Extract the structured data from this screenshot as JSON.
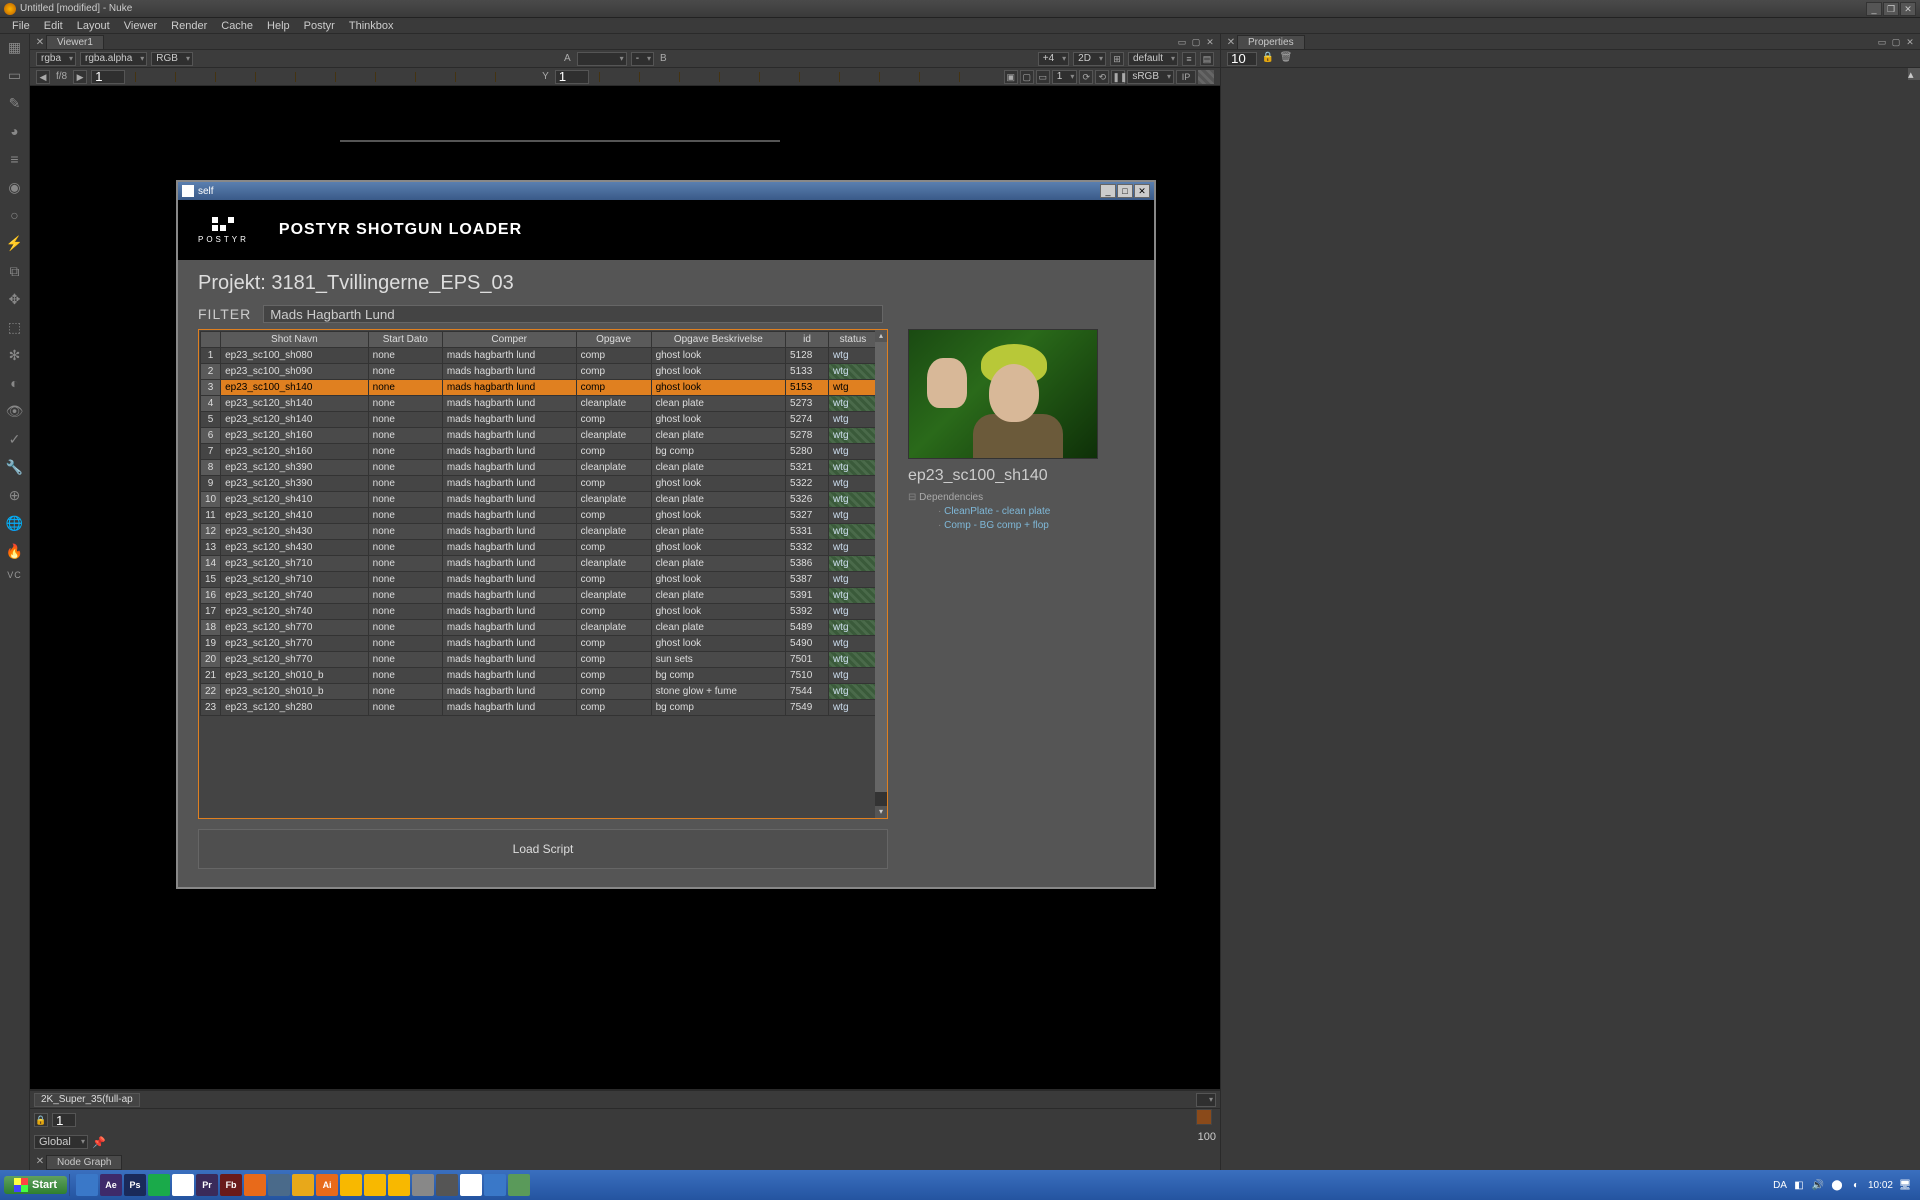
{
  "app": {
    "title": "Untitled [modified] - Nuke"
  },
  "menus": [
    "File",
    "Edit",
    "Layout",
    "Viewer",
    "Render",
    "Cache",
    "Help",
    "Postyr",
    "Thinkbox"
  ],
  "viewer": {
    "tab": "Viewer1",
    "channel1": "rgba",
    "channel2": "rgba.alpha",
    "channel3": "RGB",
    "A": "A",
    "Adash": "-",
    "B": "B",
    "zoom": "+4",
    "mode": "2D",
    "lut": "default",
    "fnum": "f/8",
    "frame": "1",
    "ylabel": "Y",
    "yval": "1",
    "srgb": "sRGB",
    "ip": "IP",
    "one": "1"
  },
  "format_strip": {
    "fmt": "2K_Super_35(full-ap",
    "num": "1",
    "scope": "Global"
  },
  "nodegraph_tab": "Node Graph",
  "properties": {
    "tab": "Properties",
    "spin": "10"
  },
  "right_extra": {
    "hundred": "100"
  },
  "dialog": {
    "window_title": "self",
    "app_title": "POSTYR SHOTGUN LOADER",
    "logo_text": "POSTYR",
    "projekt_label": "Projekt: ",
    "projekt": "3181_Tvillingerne_EPS_03",
    "filter_label": "FILTER",
    "filter_value": "Mads Hagbarth Lund",
    "columns": [
      "",
      "Shot Navn",
      "Start Dato",
      "Comper",
      "Opgave",
      "Opgave Beskrivelse",
      "id",
      "status"
    ],
    "selected_row": 3,
    "rows": [
      {
        "n": 1,
        "shot": "ep23_sc100_sh080",
        "start": "none",
        "comper": "mads hagbarth lund",
        "opg": "comp",
        "beskr": "ghost look",
        "id": "5128",
        "status": "wtg"
      },
      {
        "n": 2,
        "shot": "ep23_sc100_sh090",
        "start": "none",
        "comper": "mads hagbarth lund",
        "opg": "comp",
        "beskr": "ghost look",
        "id": "5133",
        "status": "wtg"
      },
      {
        "n": 3,
        "shot": "ep23_sc100_sh140",
        "start": "none",
        "comper": "mads hagbarth lund",
        "opg": "comp",
        "beskr": "ghost look",
        "id": "5153",
        "status": "wtg"
      },
      {
        "n": 4,
        "shot": "ep23_sc120_sh140",
        "start": "none",
        "comper": "mads hagbarth lund",
        "opg": "cleanplate",
        "beskr": "clean plate",
        "id": "5273",
        "status": "wtg"
      },
      {
        "n": 5,
        "shot": "ep23_sc120_sh140",
        "start": "none",
        "comper": "mads hagbarth lund",
        "opg": "comp",
        "beskr": "ghost look",
        "id": "5274",
        "status": "wtg"
      },
      {
        "n": 6,
        "shot": "ep23_sc120_sh160",
        "start": "none",
        "comper": "mads hagbarth lund",
        "opg": "cleanplate",
        "beskr": "clean plate",
        "id": "5278",
        "status": "wtg"
      },
      {
        "n": 7,
        "shot": "ep23_sc120_sh160",
        "start": "none",
        "comper": "mads hagbarth lund",
        "opg": "comp",
        "beskr": "bg comp",
        "id": "5280",
        "status": "wtg"
      },
      {
        "n": 8,
        "shot": "ep23_sc120_sh390",
        "start": "none",
        "comper": "mads hagbarth lund",
        "opg": "cleanplate",
        "beskr": "clean plate",
        "id": "5321",
        "status": "wtg"
      },
      {
        "n": 9,
        "shot": "ep23_sc120_sh390",
        "start": "none",
        "comper": "mads hagbarth lund",
        "opg": "comp",
        "beskr": "ghost look",
        "id": "5322",
        "status": "wtg"
      },
      {
        "n": 10,
        "shot": "ep23_sc120_sh410",
        "start": "none",
        "comper": "mads hagbarth lund",
        "opg": "cleanplate",
        "beskr": "clean plate",
        "id": "5326",
        "status": "wtg"
      },
      {
        "n": 11,
        "shot": "ep23_sc120_sh410",
        "start": "none",
        "comper": "mads hagbarth lund",
        "opg": "comp",
        "beskr": "ghost look",
        "id": "5327",
        "status": "wtg"
      },
      {
        "n": 12,
        "shot": "ep23_sc120_sh430",
        "start": "none",
        "comper": "mads hagbarth lund",
        "opg": "cleanplate",
        "beskr": "clean plate",
        "id": "5331",
        "status": "wtg"
      },
      {
        "n": 13,
        "shot": "ep23_sc120_sh430",
        "start": "none",
        "comper": "mads hagbarth lund",
        "opg": "comp",
        "beskr": "ghost look",
        "id": "5332",
        "status": "wtg"
      },
      {
        "n": 14,
        "shot": "ep23_sc120_sh710",
        "start": "none",
        "comper": "mads hagbarth lund",
        "opg": "cleanplate",
        "beskr": "clean plate",
        "id": "5386",
        "status": "wtg"
      },
      {
        "n": 15,
        "shot": "ep23_sc120_sh710",
        "start": "none",
        "comper": "mads hagbarth lund",
        "opg": "comp",
        "beskr": "ghost look",
        "id": "5387",
        "status": "wtg"
      },
      {
        "n": 16,
        "shot": "ep23_sc120_sh740",
        "start": "none",
        "comper": "mads hagbarth lund",
        "opg": "cleanplate",
        "beskr": "clean plate",
        "id": "5391",
        "status": "wtg"
      },
      {
        "n": 17,
        "shot": "ep23_sc120_sh740",
        "start": "none",
        "comper": "mads hagbarth lund",
        "opg": "comp",
        "beskr": "ghost look",
        "id": "5392",
        "status": "wtg"
      },
      {
        "n": 18,
        "shot": "ep23_sc120_sh770",
        "start": "none",
        "comper": "mads hagbarth lund",
        "opg": "cleanplate",
        "beskr": "clean plate",
        "id": "5489",
        "status": "wtg"
      },
      {
        "n": 19,
        "shot": "ep23_sc120_sh770",
        "start": "none",
        "comper": "mads hagbarth lund",
        "opg": "comp",
        "beskr": "ghost look",
        "id": "5490",
        "status": "wtg"
      },
      {
        "n": 20,
        "shot": "ep23_sc120_sh770",
        "start": "none",
        "comper": "mads hagbarth lund",
        "opg": "comp",
        "beskr": "sun sets",
        "id": "7501",
        "status": "wtg"
      },
      {
        "n": 21,
        "shot": "ep23_sc120_sh010_b",
        "start": "none",
        "comper": "mads hagbarth lund",
        "opg": "comp",
        "beskr": "bg comp",
        "id": "7510",
        "status": "wtg"
      },
      {
        "n": 22,
        "shot": "ep23_sc120_sh010_b",
        "start": "none",
        "comper": "mads hagbarth lund",
        "opg": "comp",
        "beskr": "stone glow + fume",
        "id": "7544",
        "status": "wtg"
      },
      {
        "n": 23,
        "shot": "ep23_sc120_sh280",
        "start": "none",
        "comper": "mads hagbarth lund",
        "opg": "comp",
        "beskr": "bg comp",
        "id": "7549",
        "status": "wtg"
      }
    ],
    "preview_shot": "ep23_sc100_sh140",
    "dependencies_label": "Dependencies",
    "dependencies": [
      "CleanPlate - clean plate",
      "Comp - BG comp + flop"
    ],
    "load_button": "Load Script"
  },
  "taskbar": {
    "start": "Start",
    "apps": [
      {
        "bg": "#3a78c8",
        "t": ""
      },
      {
        "bg": "#3e2a6a",
        "t": "Ae"
      },
      {
        "bg": "#1a2a5a",
        "t": "Ps"
      },
      {
        "bg": "#1aaa4a",
        "t": ""
      },
      {
        "bg": "#fff",
        "t": ""
      },
      {
        "bg": "#3a2a5a",
        "t": "Pr"
      },
      {
        "bg": "#6a1a1a",
        "t": "Fb"
      },
      {
        "bg": "#e86a1a",
        "t": ""
      },
      {
        "bg": "#4a6a8a",
        "t": ""
      },
      {
        "bg": "#e8a81a",
        "t": ""
      },
      {
        "bg": "#e86a1a",
        "t": "Ai"
      },
      {
        "bg": "#f8b800",
        "t": ""
      },
      {
        "bg": "#f8b800",
        "t": ""
      },
      {
        "bg": "#f8b800",
        "t": ""
      },
      {
        "bg": "#888",
        "t": ""
      },
      {
        "bg": "#555",
        "t": ""
      },
      {
        "bg": "#fff",
        "t": ""
      },
      {
        "bg": "#3a78c8",
        "t": ""
      },
      {
        "bg": "#5a9a5a",
        "t": ""
      }
    ],
    "lang": "DA",
    "time": "10:02"
  }
}
